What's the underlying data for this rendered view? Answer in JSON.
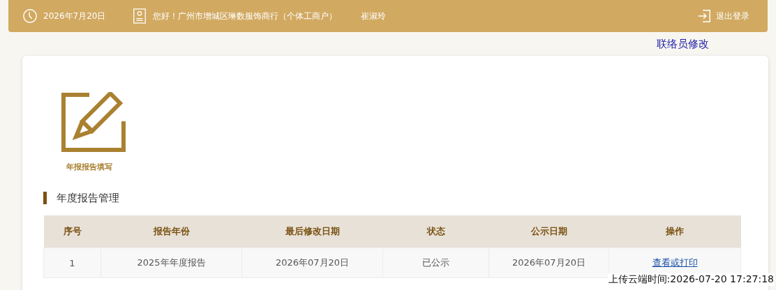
{
  "header": {
    "date": "2026年7月20日",
    "greeting": "您好！广州市增城区琳数服饰商行（个体工商户）",
    "user": "崔淑玲",
    "logout": "退出登录"
  },
  "contact_link": "联络员修改",
  "shortcuts": [
    {
      "label": "年报报告填写"
    }
  ],
  "section_title": "年度报告管理",
  "table": {
    "columns": [
      "序号",
      "报告年份",
      "最后修改日期",
      "状态",
      "公示日期",
      "操作"
    ],
    "rows": [
      {
        "cells": [
          "1",
          "2025年年度报告",
          "2026年07月20日",
          "已公示",
          "2026年07月20日"
        ],
        "action": "查看或打印"
      }
    ]
  },
  "upload_time": "上传云端时间:2026-07-20 17:27:18"
}
